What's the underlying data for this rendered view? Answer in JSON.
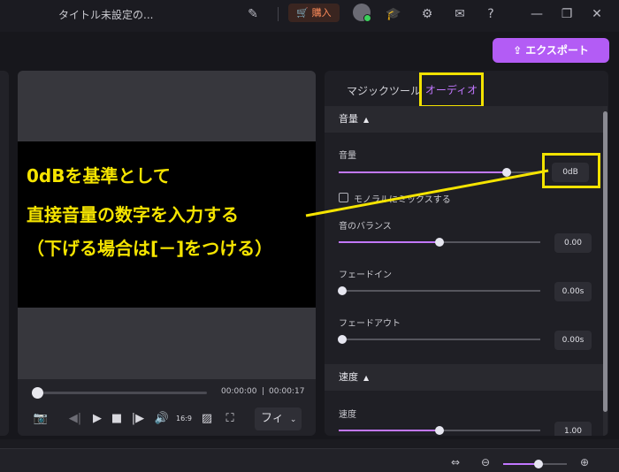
{
  "titlebar": {
    "app_title": "タイトル未設定の...",
    "buy_label": "購入",
    "icons": [
      "note-icon",
      "cart-icon",
      "user-avatar",
      "graduation-cap-icon",
      "toolbox-icon",
      "mail-icon",
      "help-icon",
      "minimize-icon",
      "maximize-icon",
      "close-icon"
    ]
  },
  "export": {
    "label": "エクスポート"
  },
  "preview": {
    "current_time": "00:00:00",
    "separator": "|",
    "total_time": "00:00:17",
    "fit_label": "フィ",
    "progress": 0.0
  },
  "panel": {
    "tabs": [
      {
        "label": "マジックツール",
        "active": false
      },
      {
        "label": "オーディオ",
        "active": true
      }
    ],
    "sections": {
      "volume": {
        "header": "音量",
        "fields": {
          "volume": {
            "label": "音量",
            "value": "0dB",
            "level": 0.84
          },
          "mono": {
            "label": "モノラルにミックスする",
            "checked": false
          },
          "balance": {
            "label": "音のバランス",
            "value": "0.00",
            "level": 0.5
          },
          "fade_in": {
            "label": "フェードイン",
            "value": "0.00s",
            "level": 0.0
          },
          "fade_out": {
            "label": "フェードアウト",
            "value": "0.00s",
            "level": 0.0
          }
        }
      },
      "speed": {
        "header": "速度",
        "fields": {
          "speed": {
            "label": "速度",
            "value": "1.00",
            "level": 0.5
          }
        }
      }
    }
  },
  "annotation": {
    "lines": [
      "0dBを基準として",
      "直接音量の数字を入力する",
      "（下げる場合は[－]をつける）"
    ],
    "color": "#f5e400"
  },
  "timeline": {
    "zoom_level": 0.55
  },
  "colors": {
    "accent": "#c277ff",
    "export": "#b35cf5",
    "highlight": "#f2e200"
  }
}
